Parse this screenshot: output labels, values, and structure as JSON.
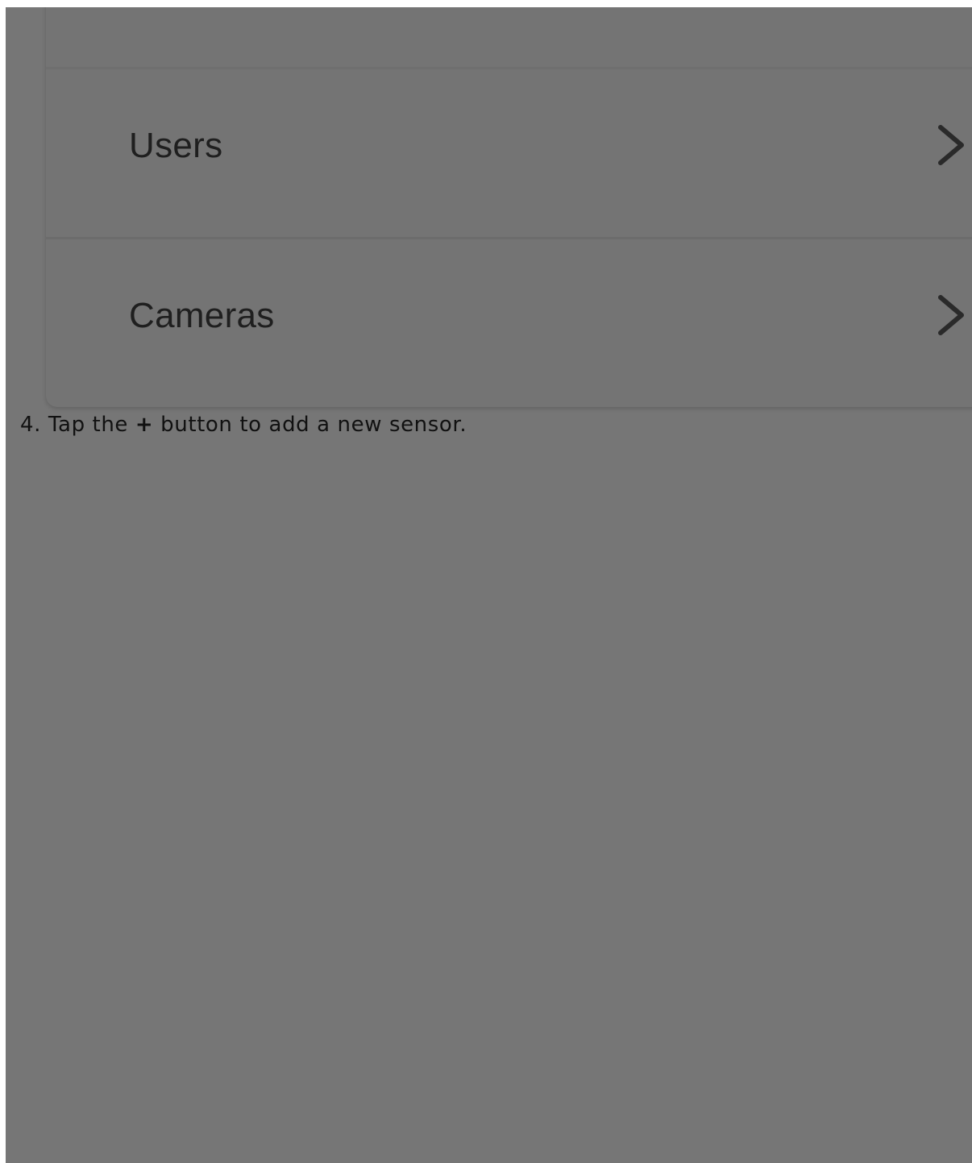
{
  "settings_list": {
    "items": [
      {
        "label": "Users",
        "icon": "chevron-right-icon"
      },
      {
        "label": "Cameras",
        "icon": "chevron-right-icon"
      }
    ]
  },
  "instruction": {
    "prefix": "4. Tap the ",
    "button_symbol": "+",
    "suffix": " button to add a new sensor."
  },
  "colors": {
    "overlay": "#767676",
    "card": "#747474",
    "text": "#1f1f1f"
  }
}
